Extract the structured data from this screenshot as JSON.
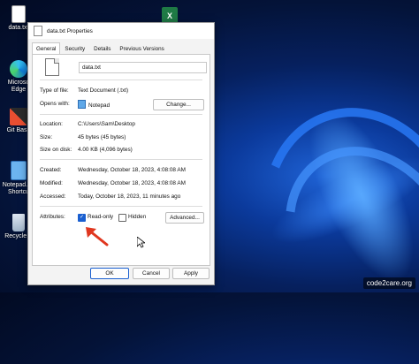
{
  "desktop": {
    "icons": [
      {
        "label": "data.txt",
        "icon": "text-file-icon"
      },
      {
        "label": "Microso Edge",
        "icon": "edge-icon"
      },
      {
        "label": "Git Bash",
        "icon": "git-bash-icon"
      },
      {
        "label": "Notepad.e - Shortcu",
        "icon": "notepad-shortcut-icon"
      },
      {
        "label": "Recycle B",
        "icon": "recycle-bin-icon"
      }
    ],
    "excel_icon": "excel-icon",
    "watermark": "code2care.org"
  },
  "dialog": {
    "title": "data.txt Properties",
    "tabs": [
      "General",
      "Security",
      "Details",
      "Previous Versions"
    ],
    "active_tab": "General",
    "filename": "data.txt",
    "fields": {
      "type_label": "Type of file:",
      "type_value": "Text Document (.txt)",
      "opens_label": "Opens with:",
      "opens_value": "Notepad",
      "change_button": "Change...",
      "location_label": "Location:",
      "location_value": "C:\\Users\\Sam\\Desktop",
      "size_label": "Size:",
      "size_value": "45 bytes (45 bytes)",
      "size_disk_label": "Size on disk:",
      "size_disk_value": "4.00 KB (4,096 bytes)",
      "created_label": "Created:",
      "created_value": "Wednesday, October 18, 2023, 4:08:08 AM",
      "modified_label": "Modified:",
      "modified_value": "Wednesday, October 18, 2023, 4:08:08 AM",
      "accessed_label": "Accessed:",
      "accessed_value": "Today, October 18, 2023, 11 minutes ago",
      "attributes_label": "Attributes:",
      "readonly_label": "Read-only",
      "readonly_checked": true,
      "hidden_label": "Hidden",
      "hidden_checked": false,
      "advanced_button": "Advanced..."
    },
    "buttons": {
      "ok": "OK",
      "cancel": "Cancel",
      "apply": "Apply"
    }
  },
  "colors": {
    "accent": "#1a5fd0",
    "arrow": "#e0371f"
  }
}
